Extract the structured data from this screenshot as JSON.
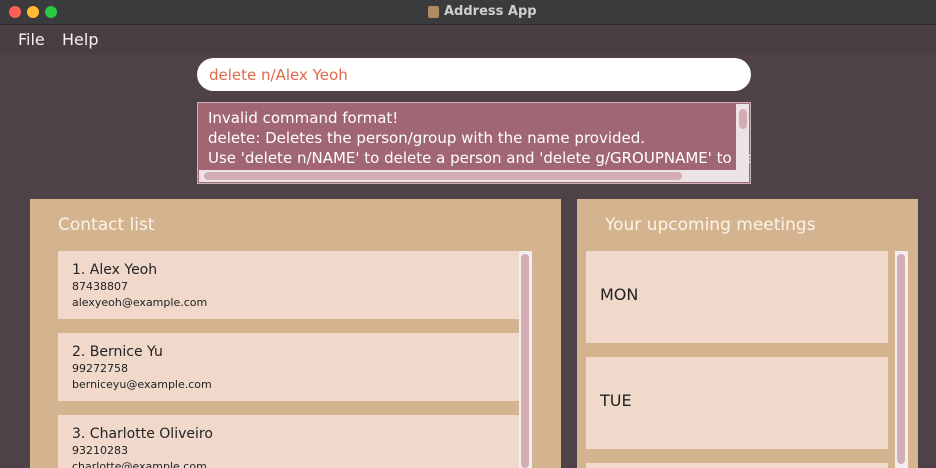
{
  "window": {
    "title": "Address App"
  },
  "menu": {
    "file": "File",
    "help": "Help"
  },
  "command": {
    "value": "delete n/Alex Yeoh"
  },
  "result": {
    "lines": [
      "Invalid command format!",
      "delete: Deletes the person/group with the name provided.",
      "Use 'delete n/NAME' to delete a person and 'delete g/GROUPNAME' to delete a group."
    ]
  },
  "contacts": {
    "title": "Contact list",
    "items": [
      {
        "name": "1.  Alex Yeoh",
        "phone": "87438807",
        "email": "alexyeoh@example.com"
      },
      {
        "name": "2.  Bernice Yu",
        "phone": "99272758",
        "email": "berniceyu@example.com"
      },
      {
        "name": "3.  Charlotte Oliveiro",
        "phone": "93210283",
        "email": "charlotte@example.com"
      }
    ]
  },
  "meetings": {
    "title": "Your upcoming meetings",
    "days": [
      "MON",
      "TUE"
    ]
  },
  "colors": {
    "background": "#4e4147",
    "panel": "#d4b48e",
    "card": "#f0d9cb",
    "result_bg": "#a16673",
    "command_text": "#e0694a"
  }
}
